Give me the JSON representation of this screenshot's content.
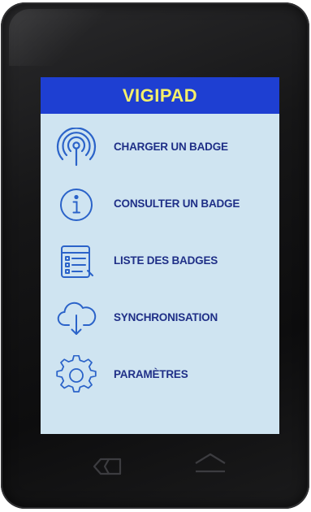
{
  "app": {
    "title": "VIGIPAD"
  },
  "menu": {
    "items": [
      {
        "label": "CHARGER UN BADGE",
        "icon": "nfc-antenna-icon"
      },
      {
        "label": "CONSULTER UN BADGE",
        "icon": "info-icon"
      },
      {
        "label": "LISTE DES BADGES",
        "icon": "list-document-icon"
      },
      {
        "label": "SYNCHRONISATION",
        "icon": "cloud-download-icon"
      },
      {
        "label": "PARAMÈTRES",
        "icon": "gear-icon"
      }
    ]
  },
  "nav": {
    "back_icon": "back-icon",
    "home_icon": "home-icon"
  },
  "colors": {
    "header_bg": "#1e3fd2",
    "title_text": "#f5f069",
    "screen_bg": "#cfe4f1",
    "label_text": "#1f2f87",
    "icon_stroke": "#2b63c9"
  }
}
